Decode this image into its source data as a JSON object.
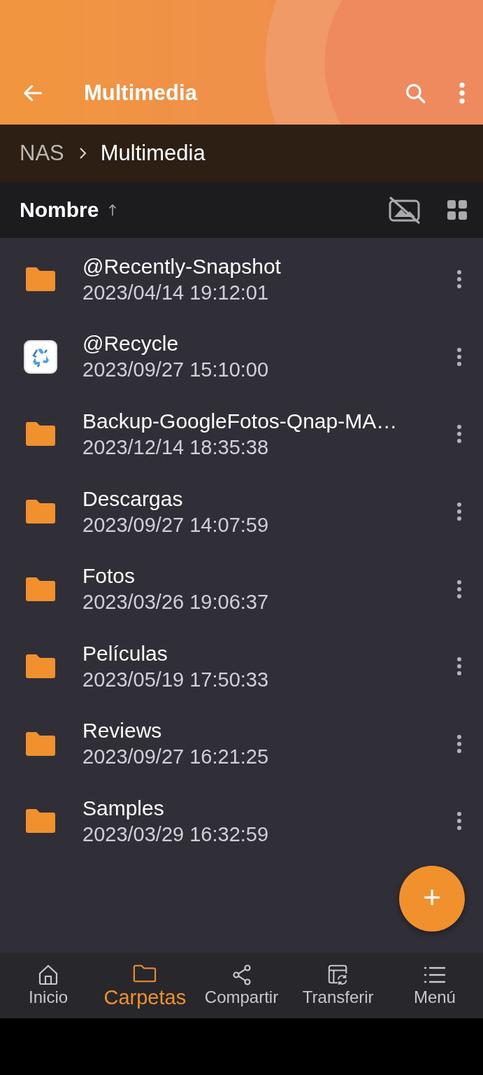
{
  "app_bar": {
    "title": "Multimedia"
  },
  "breadcrumb": [
    {
      "label": "NAS",
      "selected": false
    },
    {
      "label": "Multimedia",
      "selected": true
    }
  ],
  "sort_bar": {
    "label": "Nombre"
  },
  "items": [
    {
      "kind": "folder",
      "name": "@Recently-Snapshot",
      "date": "2023/04/14 19:12:01"
    },
    {
      "kind": "recycle",
      "name": "@Recycle",
      "date": "2023/09/27 15:10:00"
    },
    {
      "kind": "folder",
      "name": "Backup-GoogleFotos-Qnap-MA…",
      "date": "2023/12/14 18:35:38"
    },
    {
      "kind": "folder",
      "name": "Descargas",
      "date": "2023/09/27 14:07:59"
    },
    {
      "kind": "folder",
      "name": "Fotos",
      "date": "2023/03/26 19:06:37"
    },
    {
      "kind": "folder",
      "name": "Películas",
      "date": "2023/05/19 17:50:33"
    },
    {
      "kind": "folder",
      "name": "Reviews",
      "date": "2023/09/27 16:21:25"
    },
    {
      "kind": "folder",
      "name": "Samples",
      "date": "2023/03/29 16:32:59"
    }
  ],
  "fab": {
    "label": "+"
  },
  "bottom_nav": [
    {
      "kind": "home",
      "label": "Inicio",
      "selected": false
    },
    {
      "kind": "folder",
      "label": "Carpetas",
      "selected": true
    },
    {
      "kind": "share",
      "label": "Compartir",
      "selected": false
    },
    {
      "kind": "transfer",
      "label": "Transferir",
      "selected": false
    },
    {
      "kind": "menu",
      "label": "Menú",
      "selected": false
    }
  ]
}
